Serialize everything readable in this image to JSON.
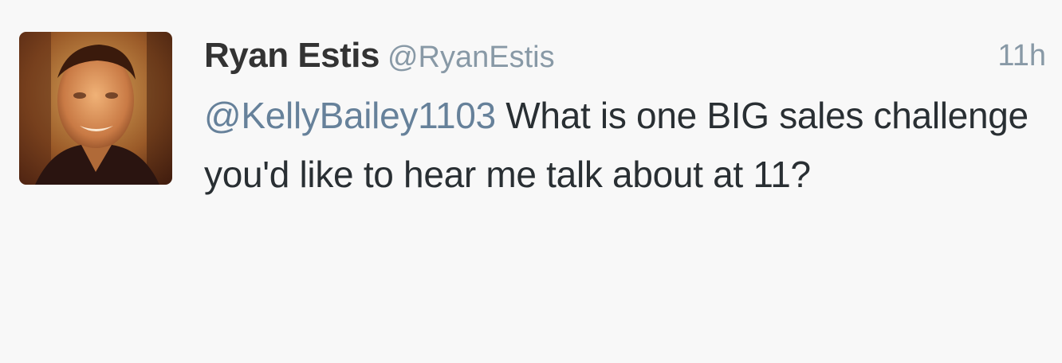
{
  "tweet": {
    "fullname": "Ryan Estis",
    "username": "@RyanEstis",
    "timestamp": "11h",
    "mention": "@KellyBailey1103",
    "body": " What is one BIG sales challenge you'd like to hear me talk about at 11?",
    "avatar_icon": "profile-photo"
  },
  "colors": {
    "background": "#f8f8f8",
    "name": "#333333",
    "meta": "#8899a6",
    "mention": "#66819a",
    "text": "#292f33"
  }
}
